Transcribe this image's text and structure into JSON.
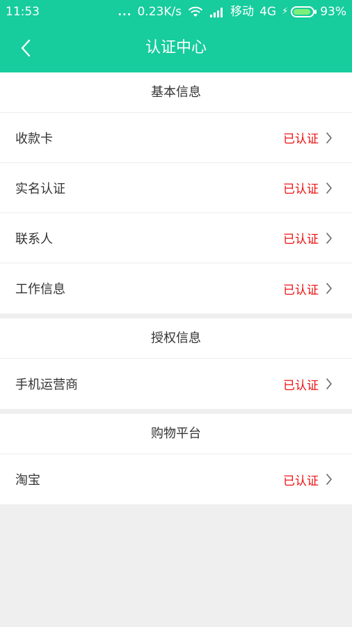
{
  "status_bar": {
    "time": "11:53",
    "dots": "...",
    "network_speed": "0.23K/s",
    "carrier": "移动",
    "network_type": "4G",
    "battery_percent": "93%",
    "battery_level": 0.93
  },
  "nav": {
    "title": "认证中心",
    "back_icon": "chevron-left-icon"
  },
  "colors": {
    "primary": "#17cc9d",
    "verified": "#ee1111",
    "background": "#efefef"
  },
  "sections": [
    {
      "title": "基本信息",
      "items": [
        {
          "label": "收款卡",
          "status": "已认证"
        },
        {
          "label": "实名认证",
          "status": "已认证"
        },
        {
          "label": "联系人",
          "status": "已认证"
        },
        {
          "label": "工作信息",
          "status": "已认证"
        }
      ]
    },
    {
      "title": "授权信息",
      "items": [
        {
          "label": "手机运营商",
          "status": "已认证"
        }
      ]
    },
    {
      "title": "购物平台",
      "items": [
        {
          "label": "淘宝",
          "status": "已认证"
        }
      ]
    }
  ]
}
